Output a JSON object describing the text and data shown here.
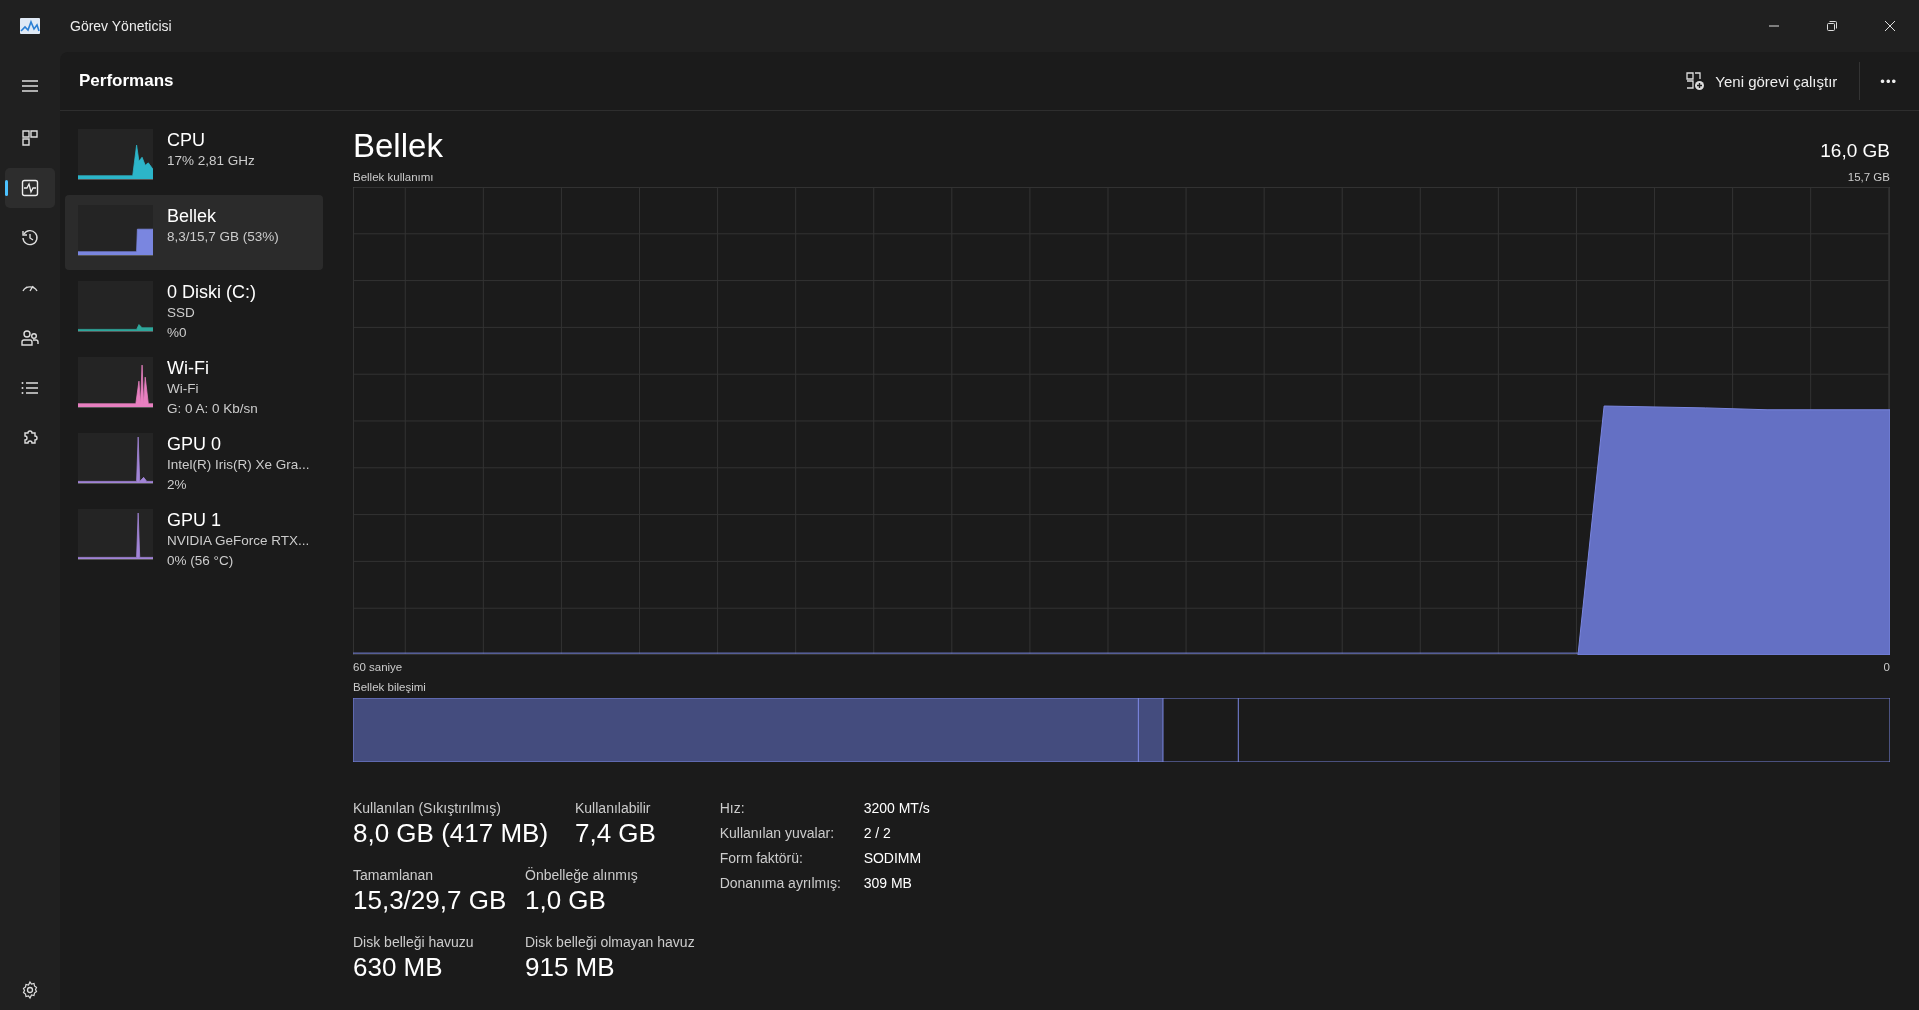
{
  "window": {
    "title": "Görev Yöneticisi"
  },
  "nav": [
    {
      "selected": false
    },
    {
      "selected": true
    },
    {
      "selected": false
    },
    {
      "selected": false
    },
    {
      "selected": false
    },
    {
      "selected": false
    },
    {
      "selected": false
    }
  ],
  "header": {
    "title": "Performans",
    "run_task": "Yeni görevi çalıştır",
    "more": "•••"
  },
  "devices": [
    {
      "name": "CPU",
      "lines": [
        "17%  2,81 GHz"
      ],
      "color": "#2cb5c9",
      "selected": false
    },
    {
      "name": "Bellek",
      "lines": [
        "8,3/15,7 GB (53%)"
      ],
      "color": "#7a86e0",
      "selected": true
    },
    {
      "name": "0 Diski (C:)",
      "lines": [
        "SSD",
        "%0"
      ],
      "color": "#2fa89c",
      "selected": false
    },
    {
      "name": "Wi-Fi",
      "lines": [
        "Wi-Fi",
        "G: 0 A: 0 Kb/sn"
      ],
      "color": "#e77fc0",
      "selected": false
    },
    {
      "name": "GPU 0",
      "lines": [
        "Intel(R) Iris(R) Xe Gra...",
        "2%"
      ],
      "color": "#a184d6",
      "selected": false
    },
    {
      "name": "GPU 1",
      "lines": [
        "NVIDIA GeForce RTX...",
        "0%  (56 °C)"
      ],
      "color": "#a184d6",
      "selected": false
    }
  ],
  "main": {
    "title": "Bellek",
    "total": "16,0 GB",
    "usage_label": "Bellek kullanımı",
    "usage_max": "15,7 GB",
    "time_start": "60 saniye",
    "time_end": "0",
    "composition_label": "Bellek bileşimi"
  },
  "stats": [
    [
      {
        "label": "Kullanılan (Sıkıştırılmış)",
        "value": "8,0 GB (417 MB)"
      },
      {
        "label": "Kullanılabilir",
        "value": "7,4 GB"
      }
    ],
    [
      {
        "label": "Tamamlanan",
        "value": "15,3/29,7 GB"
      },
      {
        "label": "Önbelleğe alınmış",
        "value": "1,0 GB"
      }
    ],
    [
      {
        "label": "Disk belleği havuzu",
        "value": "630 MB"
      },
      {
        "label": "Disk belleği olmayan havuz",
        "value": "915 MB"
      }
    ]
  ],
  "details": [
    {
      "label": "Hız:",
      "value": "3200 MT/s"
    },
    {
      "label": "Kullanılan yuvalar:",
      "value": "2 / 2"
    },
    {
      "label": "Form faktörü:",
      "value": "SODIMM"
    },
    {
      "label": "Donanıma ayrılmış:",
      "value": "309 MB"
    }
  ]
}
